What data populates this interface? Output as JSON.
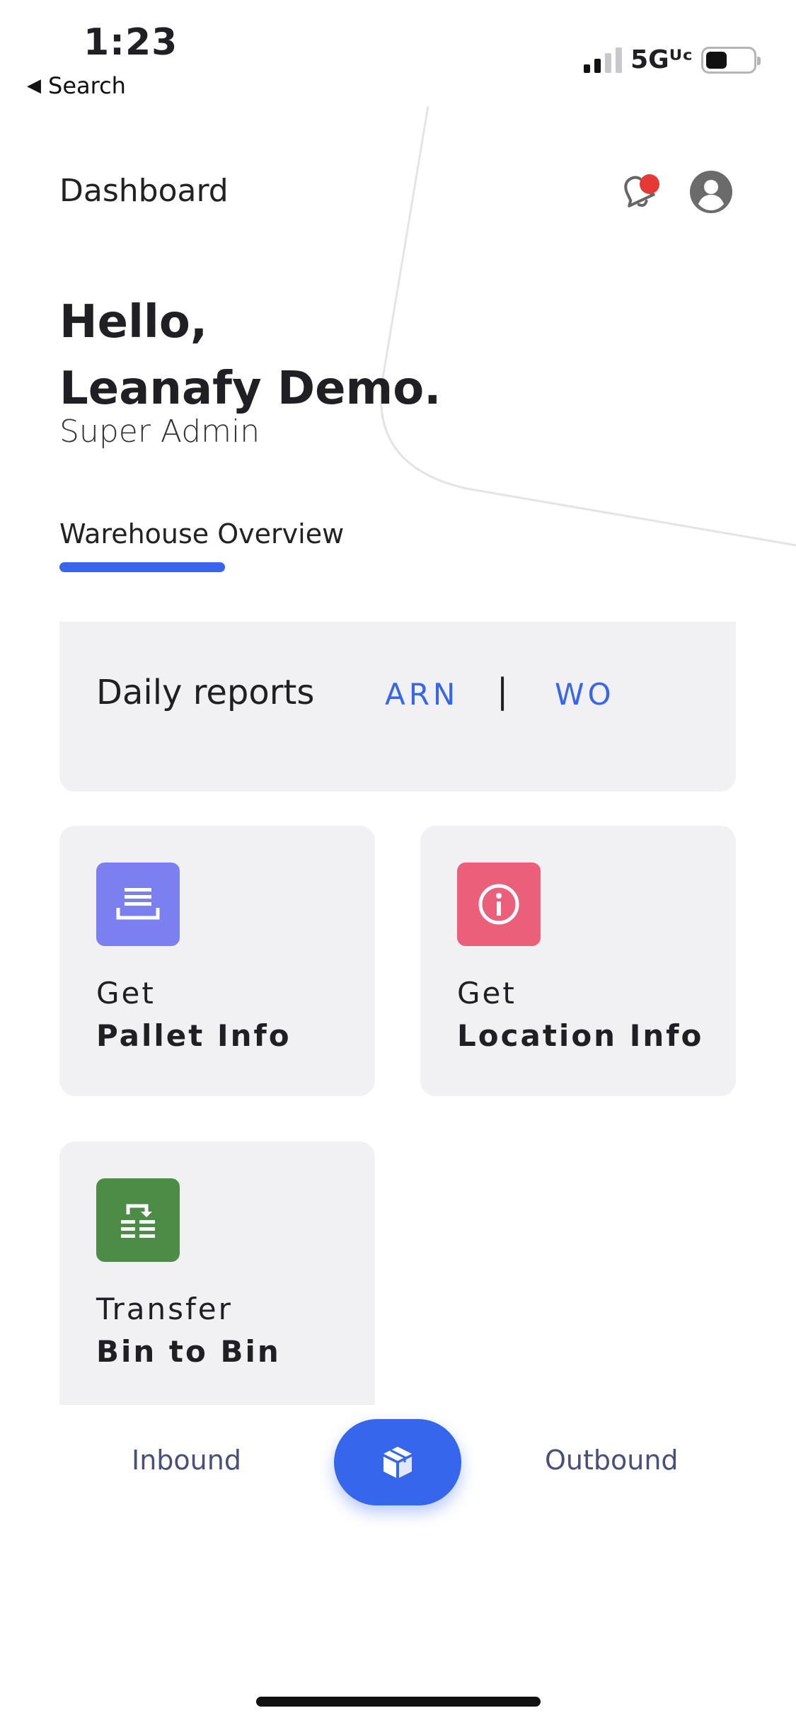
{
  "status_bar": {
    "time": "1:23",
    "back_label": "Search",
    "network": "5Gᵁᶜ"
  },
  "header": {
    "title": "Dashboard",
    "notification_icon": "bell-icon",
    "profile_icon": "account-circle-icon"
  },
  "greeting": {
    "line1": "Hello,",
    "line2": "Leanafy Demo.",
    "role": "Super Admin"
  },
  "tabs": [
    {
      "label": "Warehouse Overview",
      "active": true
    }
  ],
  "daily_reports": {
    "title": "Daily reports",
    "link1": "ARN",
    "separator": "|",
    "link2": "WO"
  },
  "tiles": [
    {
      "line1": "Get",
      "line2": "Pallet Info",
      "icon": "pallet-icon",
      "color": "#7b7ff0"
    },
    {
      "line1": "Get",
      "line2": "Location Info",
      "icon": "info-icon",
      "color": "#ea5f7a"
    },
    {
      "line1": "Transfer",
      "line2": "Bin to Bin",
      "icon": "transfer-icon",
      "color": "#4c8c46"
    }
  ],
  "bottom_nav": {
    "left": "Inbound",
    "center_icon": "box-icon",
    "right": "Outbound"
  },
  "colors": {
    "accent": "#3566eb",
    "card_bg": "#f1f1f3",
    "notification_dot": "#e53935"
  }
}
